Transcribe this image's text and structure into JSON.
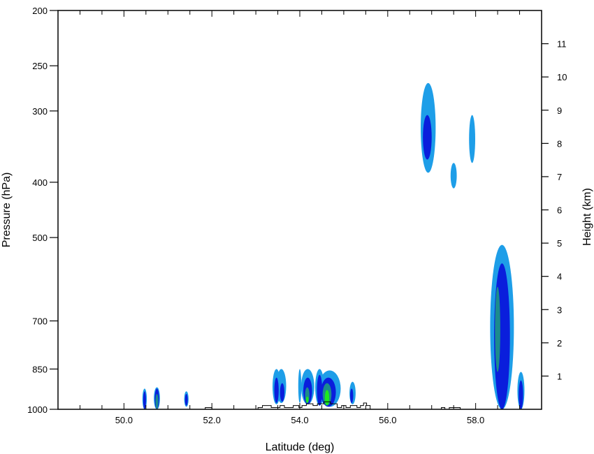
{
  "chart_data": {
    "type": "contour",
    "title": "",
    "xlabel": "Latitude (deg)",
    "ylabel": "Pressure (hPa)",
    "y2label": "Height (km)",
    "xlim": [
      48.5,
      59.5
    ],
    "ylim": [
      1000,
      200
    ],
    "y2lim": [
      0,
      12
    ],
    "x_ticks": [
      50.0,
      52.0,
      54.0,
      56.0,
      58.0
    ],
    "x_tick_labels": [
      "50.0",
      "52.0",
      "54.0",
      "56.0",
      "58.0"
    ],
    "y_ticks": [
      200,
      250,
      300,
      400,
      500,
      700,
      850,
      1000
    ],
    "y_tick_labels": [
      "200",
      "250",
      "300",
      "400",
      "500",
      "700",
      "850",
      "1000"
    ],
    "y2_ticks": [
      1,
      2,
      3,
      4,
      5,
      6,
      7,
      8,
      9,
      10,
      11
    ],
    "y2_tick_labels": [
      "1",
      "2",
      "3",
      "4",
      "5",
      "6",
      "7",
      "8",
      "9",
      "10",
      "11"
    ],
    "levels": [
      {
        "level": 1,
        "color": "#1e9ee8"
      },
      {
        "level": 2,
        "color": "#0a1edc"
      },
      {
        "level": 3,
        "color": "#1c8c8c"
      },
      {
        "level": 4,
        "color": "#1ee81e"
      }
    ],
    "blobs": [
      {
        "level": 1,
        "cx": 50.47,
        "p_top": 920,
        "p_bot": 1000,
        "w": 0.05
      },
      {
        "level": 2,
        "cx": 50.47,
        "p_top": 930,
        "p_bot": 1000,
        "w": 0.025
      },
      {
        "level": 1,
        "cx": 50.75,
        "p_top": 915,
        "p_bot": 1000,
        "w": 0.07
      },
      {
        "level": 2,
        "cx": 50.75,
        "p_top": 920,
        "p_bot": 1000,
        "w": 0.05
      },
      {
        "level": 3,
        "cx": 50.75,
        "p_top": 940,
        "p_bot": 1000,
        "w": 0.02
      },
      {
        "level": 1,
        "cx": 51.42,
        "p_top": 930,
        "p_bot": 990,
        "w": 0.05
      },
      {
        "level": 2,
        "cx": 51.42,
        "p_top": 940,
        "p_bot": 985,
        "w": 0.025
      },
      {
        "level": 1,
        "cx": 53.47,
        "p_top": 850,
        "p_bot": 980,
        "w": 0.09
      },
      {
        "level": 2,
        "cx": 53.47,
        "p_top": 880,
        "p_bot": 975,
        "w": 0.05
      },
      {
        "level": 1,
        "cx": 53.58,
        "p_top": 850,
        "p_bot": 975,
        "w": 0.11
      },
      {
        "level": 2,
        "cx": 53.6,
        "p_top": 900,
        "p_bot": 970,
        "w": 0.05
      },
      {
        "level": 1,
        "cx": 54.0,
        "p_top": 850,
        "p_bot": 975,
        "w": 0.035
      },
      {
        "level": 1,
        "cx": 54.18,
        "p_top": 850,
        "p_bot": 980,
        "w": 0.15
      },
      {
        "level": 2,
        "cx": 54.18,
        "p_top": 880,
        "p_bot": 980,
        "w": 0.1
      },
      {
        "level": 3,
        "cx": 54.17,
        "p_top": 915,
        "p_bot": 975,
        "w": 0.05
      },
      {
        "level": 4,
        "cx": 54.17,
        "p_top": 950,
        "p_bot": 975,
        "w": 0.025
      },
      {
        "level": 1,
        "cx": 54.45,
        "p_top": 850,
        "p_bot": 985,
        "w": 0.1
      },
      {
        "level": 2,
        "cx": 54.45,
        "p_top": 870,
        "p_bot": 985,
        "w": 0.06
      },
      {
        "level": 1,
        "cx": 54.68,
        "p_top": 855,
        "p_bot": 990,
        "w": 0.25
      },
      {
        "level": 2,
        "cx": 54.65,
        "p_top": 880,
        "p_bot": 990,
        "w": 0.17
      },
      {
        "level": 3,
        "cx": 54.62,
        "p_top": 900,
        "p_bot": 985,
        "w": 0.1
      },
      {
        "level": 4,
        "cx": 54.62,
        "p_top": 925,
        "p_bot": 985,
        "w": 0.05
      },
      {
        "level": 1,
        "cx": 55.2,
        "p_top": 895,
        "p_bot": 980,
        "w": 0.07
      },
      {
        "level": 2,
        "cx": 55.18,
        "p_top": 920,
        "p_bot": 975,
        "w": 0.035
      },
      {
        "level": 1,
        "cx": 56.92,
        "p_top": 268,
        "p_bot": 385,
        "w": 0.17
      },
      {
        "level": 2,
        "cx": 56.9,
        "p_top": 305,
        "p_bot": 365,
        "w": 0.1
      },
      {
        "level": 1,
        "cx": 57.5,
        "p_top": 370,
        "p_bot": 410,
        "w": 0.07
      },
      {
        "level": 1,
        "cx": 57.92,
        "p_top": 305,
        "p_bot": 370,
        "w": 0.07
      },
      {
        "level": 1,
        "cx": 58.6,
        "p_top": 515,
        "p_bot": 1000,
        "w": 0.27
      },
      {
        "level": 2,
        "cx": 58.6,
        "p_top": 555,
        "p_bot": 1000,
        "w": 0.18
      },
      {
        "level": 3,
        "cx": 58.5,
        "p_top": 610,
        "p_bot": 860,
        "w": 0.06
      },
      {
        "level": 1,
        "cx": 59.03,
        "p_top": 860,
        "p_bot": 1000,
        "w": 0.08
      },
      {
        "level": 2,
        "cx": 59.03,
        "p_top": 890,
        "p_bot": 1000,
        "w": 0.05
      }
    ],
    "terrain": [
      [
        51.85,
        1000
      ],
      [
        51.85,
        993
      ],
      [
        52.0,
        993
      ],
      [
        52.0,
        1000
      ],
      [
        53.05,
        1000
      ],
      [
        53.05,
        993
      ],
      [
        53.15,
        993
      ],
      [
        53.15,
        985
      ],
      [
        53.35,
        985
      ],
      [
        53.35,
        993
      ],
      [
        53.55,
        993
      ],
      [
        53.55,
        985
      ],
      [
        53.65,
        985
      ],
      [
        53.65,
        993
      ],
      [
        53.85,
        993
      ],
      [
        53.85,
        985
      ],
      [
        53.98,
        985
      ],
      [
        53.98,
        993
      ],
      [
        54.05,
        993
      ],
      [
        54.05,
        985
      ],
      [
        54.15,
        985
      ],
      [
        54.15,
        978
      ],
      [
        54.3,
        978
      ],
      [
        54.3,
        985
      ],
      [
        54.4,
        985
      ],
      [
        54.4,
        978
      ],
      [
        54.55,
        978
      ],
      [
        54.55,
        970
      ],
      [
        54.7,
        970
      ],
      [
        54.7,
        978
      ],
      [
        54.85,
        978
      ],
      [
        54.85,
        993
      ],
      [
        54.95,
        993
      ],
      [
        54.95,
        985
      ],
      [
        55.05,
        985
      ],
      [
        55.05,
        993
      ],
      [
        55.15,
        993
      ],
      [
        55.15,
        985
      ],
      [
        55.3,
        985
      ],
      [
        55.3,
        993
      ],
      [
        55.38,
        993
      ],
      [
        55.38,
        985
      ],
      [
        55.45,
        985
      ],
      [
        55.45,
        975
      ],
      [
        55.52,
        975
      ],
      [
        55.52,
        985
      ],
      [
        55.6,
        985
      ],
      [
        55.6,
        1000
      ],
      [
        57.22,
        1000
      ],
      [
        57.22,
        993
      ],
      [
        57.3,
        993
      ],
      [
        57.3,
        1000
      ],
      [
        57.4,
        1000
      ],
      [
        57.4,
        993
      ],
      [
        57.65,
        993
      ],
      [
        57.65,
        1000
      ]
    ]
  }
}
